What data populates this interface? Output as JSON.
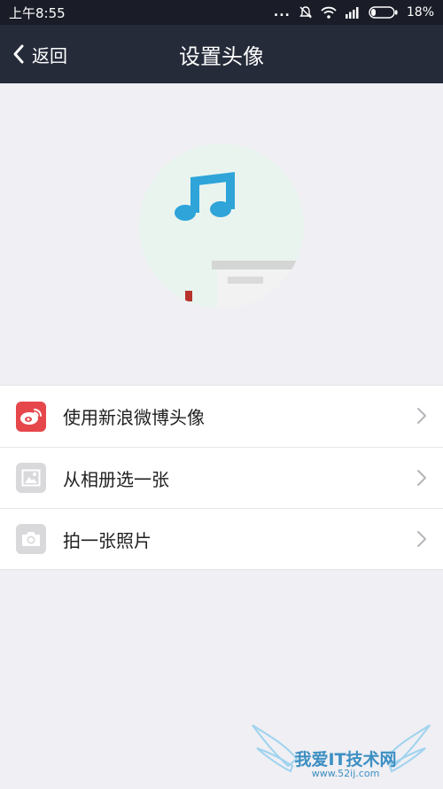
{
  "status_bar": {
    "time": "上午8:55",
    "signal_dots": "...",
    "battery": "18%"
  },
  "header": {
    "back_label": "返回",
    "title": "设置头像"
  },
  "menu": {
    "items": [
      {
        "label": "使用新浪微博头像",
        "icon": "weibo-icon",
        "icon_color": "#e6474b"
      },
      {
        "label": "从相册选一张",
        "icon": "album-icon",
        "icon_color": "#d9d9dc"
      },
      {
        "label": "拍一张照片",
        "icon": "camera-icon",
        "icon_color": "#d9d9dc"
      }
    ]
  },
  "watermark": {
    "text": "我爱IT技术网",
    "url": "www.52ij.com"
  },
  "colors": {
    "header_bg": "#262b3a",
    "status_bg": "#1a1d28",
    "page_bg": "#efeff4",
    "avatar_note": "#2ea4d9"
  }
}
